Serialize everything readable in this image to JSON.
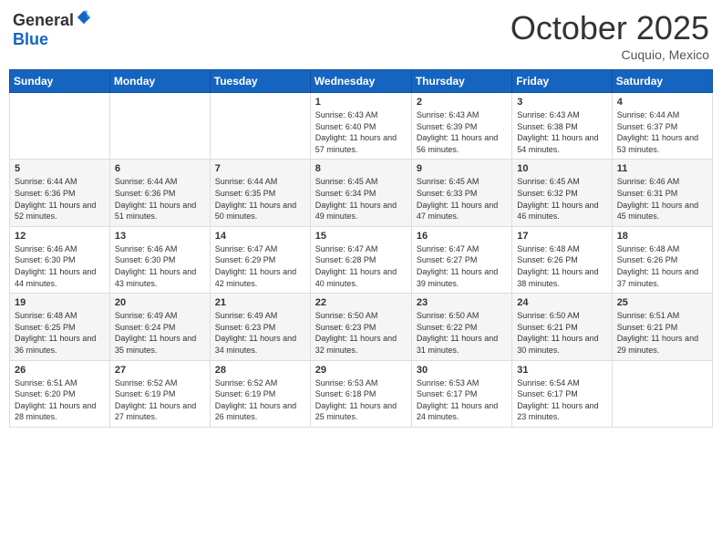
{
  "header": {
    "logo_general": "General",
    "logo_blue": "Blue",
    "month": "October 2025",
    "location": "Cuquio, Mexico"
  },
  "weekdays": [
    "Sunday",
    "Monday",
    "Tuesday",
    "Wednesday",
    "Thursday",
    "Friday",
    "Saturday"
  ],
  "weeks": [
    [
      {
        "day": "",
        "sunrise": "",
        "sunset": "",
        "daylight": ""
      },
      {
        "day": "",
        "sunrise": "",
        "sunset": "",
        "daylight": ""
      },
      {
        "day": "",
        "sunrise": "",
        "sunset": "",
        "daylight": ""
      },
      {
        "day": "1",
        "sunrise": "Sunrise: 6:43 AM",
        "sunset": "Sunset: 6:40 PM",
        "daylight": "Daylight: 11 hours and 57 minutes."
      },
      {
        "day": "2",
        "sunrise": "Sunrise: 6:43 AM",
        "sunset": "Sunset: 6:39 PM",
        "daylight": "Daylight: 11 hours and 56 minutes."
      },
      {
        "day": "3",
        "sunrise": "Sunrise: 6:43 AM",
        "sunset": "Sunset: 6:38 PM",
        "daylight": "Daylight: 11 hours and 54 minutes."
      },
      {
        "day": "4",
        "sunrise": "Sunrise: 6:44 AM",
        "sunset": "Sunset: 6:37 PM",
        "daylight": "Daylight: 11 hours and 53 minutes."
      }
    ],
    [
      {
        "day": "5",
        "sunrise": "Sunrise: 6:44 AM",
        "sunset": "Sunset: 6:36 PM",
        "daylight": "Daylight: 11 hours and 52 minutes."
      },
      {
        "day": "6",
        "sunrise": "Sunrise: 6:44 AM",
        "sunset": "Sunset: 6:36 PM",
        "daylight": "Daylight: 11 hours and 51 minutes."
      },
      {
        "day": "7",
        "sunrise": "Sunrise: 6:44 AM",
        "sunset": "Sunset: 6:35 PM",
        "daylight": "Daylight: 11 hours and 50 minutes."
      },
      {
        "day": "8",
        "sunrise": "Sunrise: 6:45 AM",
        "sunset": "Sunset: 6:34 PM",
        "daylight": "Daylight: 11 hours and 49 minutes."
      },
      {
        "day": "9",
        "sunrise": "Sunrise: 6:45 AM",
        "sunset": "Sunset: 6:33 PM",
        "daylight": "Daylight: 11 hours and 47 minutes."
      },
      {
        "day": "10",
        "sunrise": "Sunrise: 6:45 AM",
        "sunset": "Sunset: 6:32 PM",
        "daylight": "Daylight: 11 hours and 46 minutes."
      },
      {
        "day": "11",
        "sunrise": "Sunrise: 6:46 AM",
        "sunset": "Sunset: 6:31 PM",
        "daylight": "Daylight: 11 hours and 45 minutes."
      }
    ],
    [
      {
        "day": "12",
        "sunrise": "Sunrise: 6:46 AM",
        "sunset": "Sunset: 6:30 PM",
        "daylight": "Daylight: 11 hours and 44 minutes."
      },
      {
        "day": "13",
        "sunrise": "Sunrise: 6:46 AM",
        "sunset": "Sunset: 6:30 PM",
        "daylight": "Daylight: 11 hours and 43 minutes."
      },
      {
        "day": "14",
        "sunrise": "Sunrise: 6:47 AM",
        "sunset": "Sunset: 6:29 PM",
        "daylight": "Daylight: 11 hours and 42 minutes."
      },
      {
        "day": "15",
        "sunrise": "Sunrise: 6:47 AM",
        "sunset": "Sunset: 6:28 PM",
        "daylight": "Daylight: 11 hours and 40 minutes."
      },
      {
        "day": "16",
        "sunrise": "Sunrise: 6:47 AM",
        "sunset": "Sunset: 6:27 PM",
        "daylight": "Daylight: 11 hours and 39 minutes."
      },
      {
        "day": "17",
        "sunrise": "Sunrise: 6:48 AM",
        "sunset": "Sunset: 6:26 PM",
        "daylight": "Daylight: 11 hours and 38 minutes."
      },
      {
        "day": "18",
        "sunrise": "Sunrise: 6:48 AM",
        "sunset": "Sunset: 6:26 PM",
        "daylight": "Daylight: 11 hours and 37 minutes."
      }
    ],
    [
      {
        "day": "19",
        "sunrise": "Sunrise: 6:48 AM",
        "sunset": "Sunset: 6:25 PM",
        "daylight": "Daylight: 11 hours and 36 minutes."
      },
      {
        "day": "20",
        "sunrise": "Sunrise: 6:49 AM",
        "sunset": "Sunset: 6:24 PM",
        "daylight": "Daylight: 11 hours and 35 minutes."
      },
      {
        "day": "21",
        "sunrise": "Sunrise: 6:49 AM",
        "sunset": "Sunset: 6:23 PM",
        "daylight": "Daylight: 11 hours and 34 minutes."
      },
      {
        "day": "22",
        "sunrise": "Sunrise: 6:50 AM",
        "sunset": "Sunset: 6:23 PM",
        "daylight": "Daylight: 11 hours and 32 minutes."
      },
      {
        "day": "23",
        "sunrise": "Sunrise: 6:50 AM",
        "sunset": "Sunset: 6:22 PM",
        "daylight": "Daylight: 11 hours and 31 minutes."
      },
      {
        "day": "24",
        "sunrise": "Sunrise: 6:50 AM",
        "sunset": "Sunset: 6:21 PM",
        "daylight": "Daylight: 11 hours and 30 minutes."
      },
      {
        "day": "25",
        "sunrise": "Sunrise: 6:51 AM",
        "sunset": "Sunset: 6:21 PM",
        "daylight": "Daylight: 11 hours and 29 minutes."
      }
    ],
    [
      {
        "day": "26",
        "sunrise": "Sunrise: 6:51 AM",
        "sunset": "Sunset: 6:20 PM",
        "daylight": "Daylight: 11 hours and 28 minutes."
      },
      {
        "day": "27",
        "sunrise": "Sunrise: 6:52 AM",
        "sunset": "Sunset: 6:19 PM",
        "daylight": "Daylight: 11 hours and 27 minutes."
      },
      {
        "day": "28",
        "sunrise": "Sunrise: 6:52 AM",
        "sunset": "Sunset: 6:19 PM",
        "daylight": "Daylight: 11 hours and 26 minutes."
      },
      {
        "day": "29",
        "sunrise": "Sunrise: 6:53 AM",
        "sunset": "Sunset: 6:18 PM",
        "daylight": "Daylight: 11 hours and 25 minutes."
      },
      {
        "day": "30",
        "sunrise": "Sunrise: 6:53 AM",
        "sunset": "Sunset: 6:17 PM",
        "daylight": "Daylight: 11 hours and 24 minutes."
      },
      {
        "day": "31",
        "sunrise": "Sunrise: 6:54 AM",
        "sunset": "Sunset: 6:17 PM",
        "daylight": "Daylight: 11 hours and 23 minutes."
      },
      {
        "day": "",
        "sunrise": "",
        "sunset": "",
        "daylight": ""
      }
    ]
  ]
}
